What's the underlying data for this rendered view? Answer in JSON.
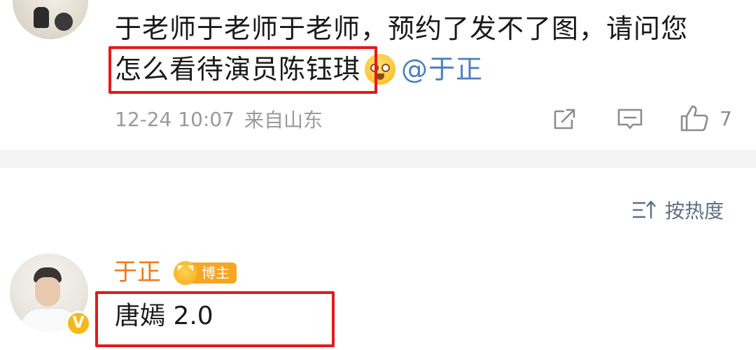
{
  "comment": {
    "line1": "于老师于老师于老师，预约了发不了图，请问您",
    "line2": "怎么看待演员陈钰琪",
    "emoji": "surprised-face-emoji",
    "mention": "@于正",
    "date": "12-24 10:07",
    "location": "来自山东",
    "like_count": "7",
    "icons": [
      "share-icon",
      "comment-icon",
      "like-icon"
    ]
  },
  "sort": {
    "label": "按热度",
    "icon": "sort-icon"
  },
  "reply": {
    "username": "于正",
    "badge_label": "博主",
    "verified_badge": "V",
    "text": "唐嫣 2.0"
  },
  "colors": {
    "highlight_border": "#e5191c",
    "mention": "#4b7fc2",
    "username": "#f07a1a",
    "badge": "#f5a623",
    "meta_text": "#9a9a9a",
    "divider": "#f3f3f3"
  }
}
